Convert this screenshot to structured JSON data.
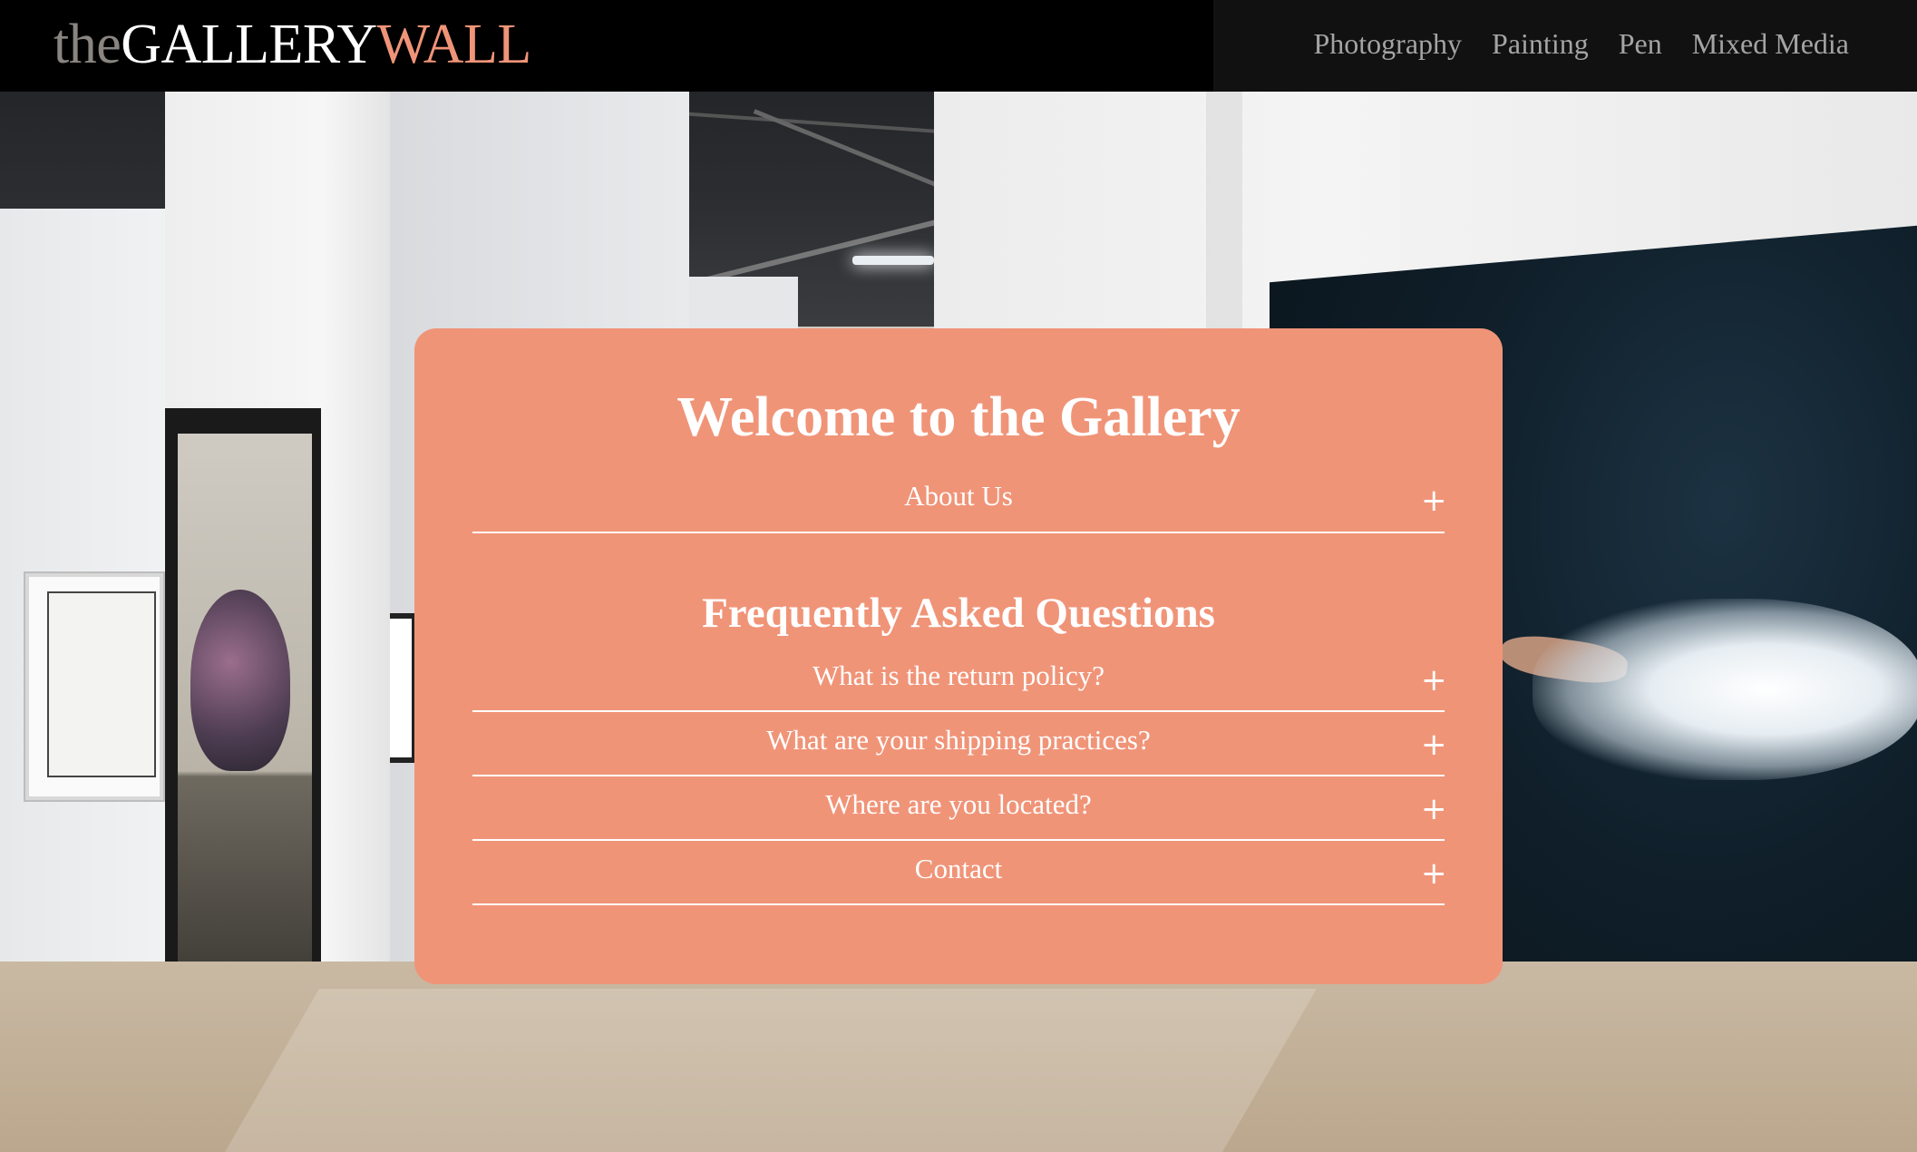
{
  "header": {
    "logo": {
      "part1": "the",
      "part2": "GALLERY",
      "part3": "WALL"
    },
    "nav": [
      "Photography",
      "Painting",
      "Pen",
      "Mixed Media"
    ]
  },
  "panel": {
    "title": "Welcome to the Gallery",
    "about": {
      "label": "About Us",
      "toggle": "+"
    },
    "faq_title": "Frequently Asked Questions",
    "faq": [
      {
        "label": "What is the return policy?",
        "toggle": "+"
      },
      {
        "label": "What are your shipping practices?",
        "toggle": "+"
      },
      {
        "label": "Where are you located?",
        "toggle": "+"
      },
      {
        "label": "Contact",
        "toggle": "+"
      }
    ]
  },
  "colors": {
    "accent": "#f09478",
    "logo_wall": "#ef9478",
    "nav_text": "#a4a4a4",
    "header_bg": "#111111"
  }
}
